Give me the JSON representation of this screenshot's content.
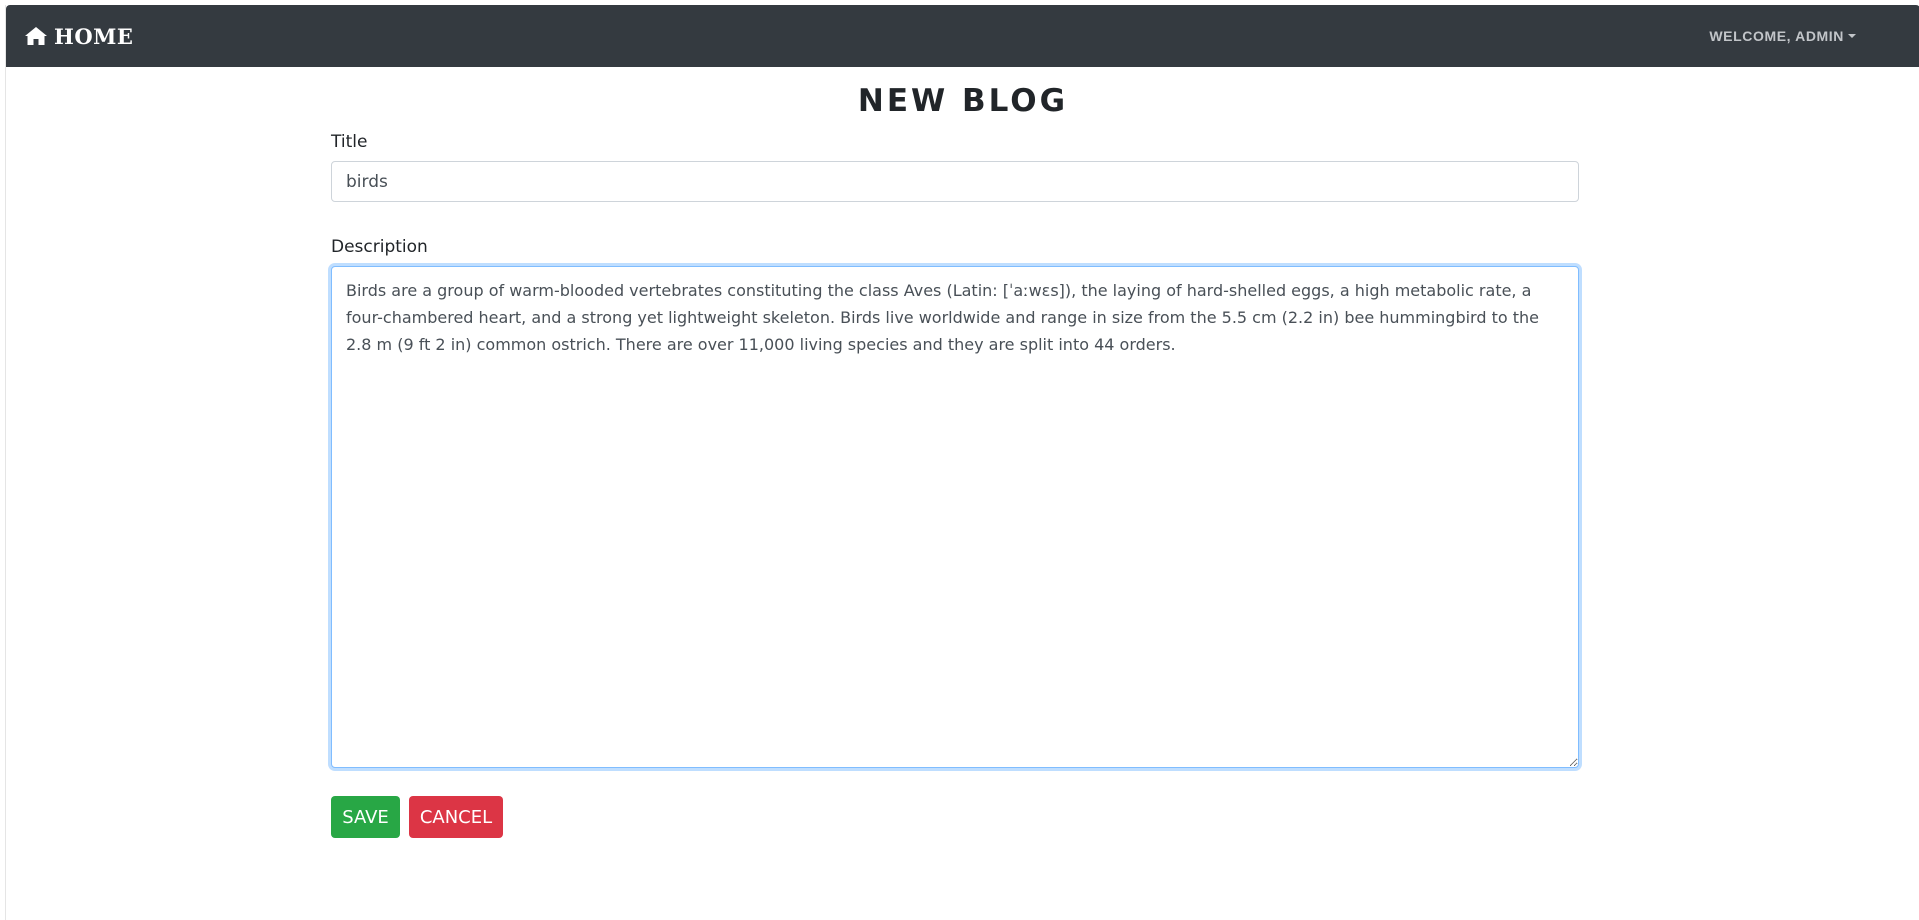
{
  "navbar": {
    "brand_label": "HOME",
    "brand_icon": "home-icon",
    "user_menu_label": "WELCOME, ADMIN",
    "colors": {
      "background": "#343a40",
      "brand_text": "#ffffff",
      "user_text": "#c2c5c9"
    }
  },
  "page": {
    "title": "NEW BLOG"
  },
  "form": {
    "title_label": "Title",
    "title_value": "birds",
    "description_label": "Description",
    "description_value": "Birds are a group of warm-blooded vertebrates constituting the class Aves (Latin: [ˈaːwɛs]), the laying of hard-shelled eggs, a high metabolic rate, a four-chambered heart, and a strong yet lightweight skeleton. Birds live worldwide and range in size from the 5.5 cm (2.2 in) bee hummingbird to the 2.8 m (9 ft 2 in) common ostrich. There are over 11,000 living species and they are split into 44 orders. "
  },
  "actions": {
    "save_label": "SAVE",
    "cancel_label": "CANCEL",
    "colors": {
      "save": "#28a745",
      "cancel": "#dc3545"
    }
  }
}
